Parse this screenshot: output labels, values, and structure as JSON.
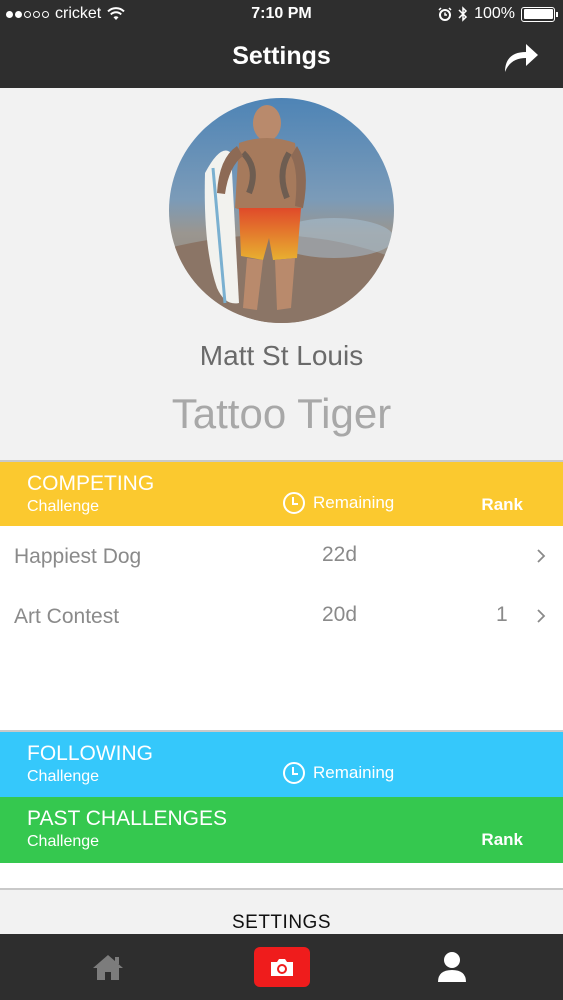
{
  "status_bar": {
    "carrier": "cricket",
    "time": "7:10 PM",
    "battery": "100%",
    "battery_level": 1.0,
    "signal_bars_filled": 2,
    "signal_bars_total": 5
  },
  "nav": {
    "title": "Settings"
  },
  "profile": {
    "name": "Matt St Louis",
    "nickname": "Tattoo Tiger"
  },
  "competing": {
    "title": "COMPETING",
    "subtitle": "Challenge",
    "remaining_label": "Remaining",
    "rank_label": "Rank",
    "color": "#fbc92f",
    "rows": [
      {
        "name": "Happiest Dog",
        "days": "22d",
        "rank": ""
      },
      {
        "name": "Art Contest",
        "days": "20d",
        "rank": "1"
      }
    ]
  },
  "following": {
    "title": "FOLLOWING",
    "subtitle": "Challenge",
    "remaining_label": "Remaining",
    "color": "#35c8fb"
  },
  "past": {
    "title": "PAST CHALLENGES",
    "subtitle": "Challenge",
    "rank_label": "Rank",
    "color": "#35c84f"
  },
  "settings_section": {
    "label": "SETTINGS"
  },
  "tab_bar": {
    "items": [
      {
        "icon": "home-icon"
      },
      {
        "icon": "camera-icon"
      },
      {
        "icon": "user-icon"
      }
    ],
    "camera_color": "#ef1c1c"
  }
}
